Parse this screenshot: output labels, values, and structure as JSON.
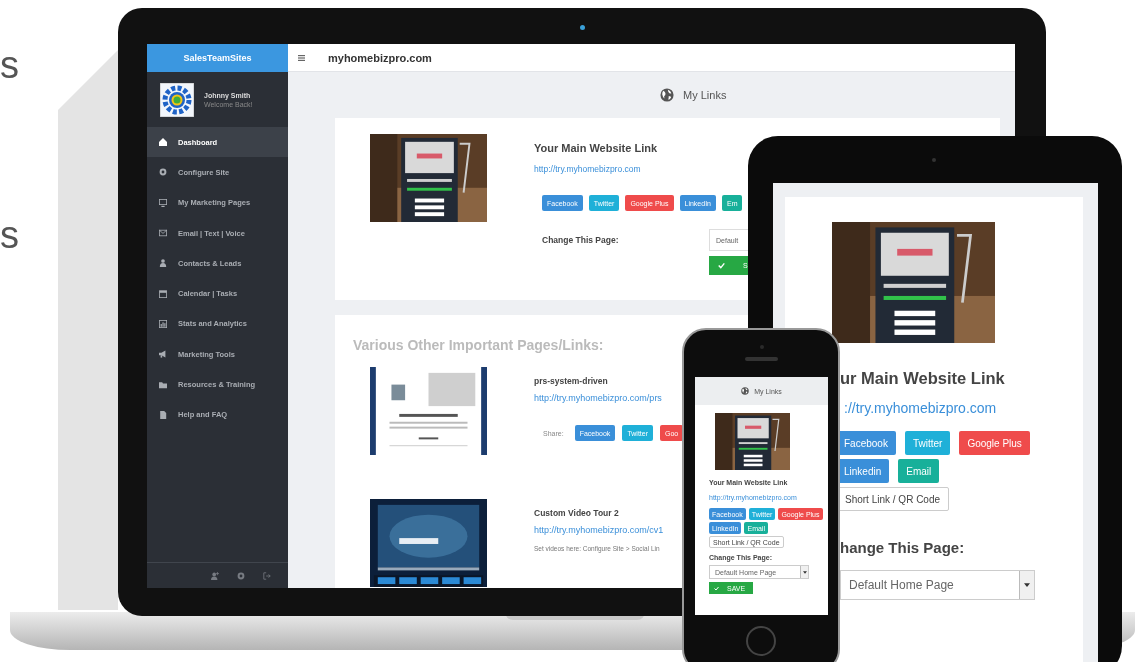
{
  "background_text": [
    "s",
    "s"
  ],
  "laptop": {
    "brand": "SalesTeamSites",
    "user": {
      "name": "Johnny Smith",
      "greeting": "Welcome Back!"
    },
    "nav": [
      {
        "label": "Dashboard",
        "selected": true
      },
      {
        "label": "Configure Site",
        "selected": false
      },
      {
        "label": "My Marketing Pages",
        "selected": false
      },
      {
        "label": "Email | Text | Voice",
        "selected": false
      },
      {
        "label": "Contacts & Leads",
        "selected": false
      },
      {
        "label": "Calendar | Tasks",
        "selected": false
      },
      {
        "label": "Stats and Analytics",
        "selected": false
      },
      {
        "label": "Marketing Tools",
        "selected": false
      },
      {
        "label": "Resources & Training",
        "selected": false
      },
      {
        "label": "Help and FAQ",
        "selected": false
      }
    ],
    "site": "myhomebizpro.com",
    "page_title": "My Links",
    "main_link": {
      "title": "Your Main Website Link",
      "url": "http://try.myhomebizpro.com",
      "share": [
        {
          "label": "Facebook",
          "kind": "facebook"
        },
        {
          "label": "Twitter",
          "kind": "twitter"
        },
        {
          "label": "Google Plus",
          "kind": "google"
        },
        {
          "label": "LinkedIn",
          "kind": "linkedin"
        },
        {
          "label": "Em",
          "kind": "email"
        }
      ],
      "change_label": "Change This Page:",
      "select_value": "Default",
      "save_label": "S"
    },
    "other": {
      "title": "Various Other Important Pages/Links:",
      "items": [
        {
          "name": "prs-system-driven",
          "url": "http://try.myhomebizpro.com/prs",
          "share_label": "Share:",
          "share": [
            {
              "label": "Facebook",
              "kind": "facebook"
            },
            {
              "label": "Twitter",
              "kind": "twitter"
            },
            {
              "label": "Goo",
              "kind": "google"
            }
          ]
        },
        {
          "name": "Custom Video Tour 2",
          "url": "http://try.myhomebizpro.com/cv1",
          "note": "Set videos here: Configure Site > Social Lin"
        }
      ]
    }
  },
  "tablet": {
    "title": "ur Main Website Link",
    "url": "://try.myhomebizpro.com",
    "share": [
      {
        "label": "Facebook",
        "kind": "facebook"
      },
      {
        "label": "Twitter",
        "kind": "twitter"
      },
      {
        "label": "Google Plus",
        "kind": "google"
      },
      {
        "label": "Linkedin",
        "kind": "linkedin"
      },
      {
        "label": "Email",
        "kind": "email"
      },
      {
        "label": "Short Link / QR Code",
        "kind": "plain"
      }
    ],
    "change_label": "hange This Page:",
    "select_value": "Default Home Page"
  },
  "phone": {
    "page_title": "My Links",
    "title": "Your Main Website Link",
    "url": "http://try.myhomebizpro.com",
    "share": [
      {
        "label": "Facebook",
        "kind": "facebook"
      },
      {
        "label": "Twitter",
        "kind": "twitter"
      },
      {
        "label": "Google Plus",
        "kind": "google"
      },
      {
        "label": "LinkedIn",
        "kind": "linkedin"
      },
      {
        "label": "Email",
        "kind": "email"
      },
      {
        "label": "Short Link / QR Code",
        "kind": "plain"
      }
    ],
    "change_label": "Change This Page:",
    "select_value": "Default Home Page",
    "save_label": "SAVE"
  }
}
